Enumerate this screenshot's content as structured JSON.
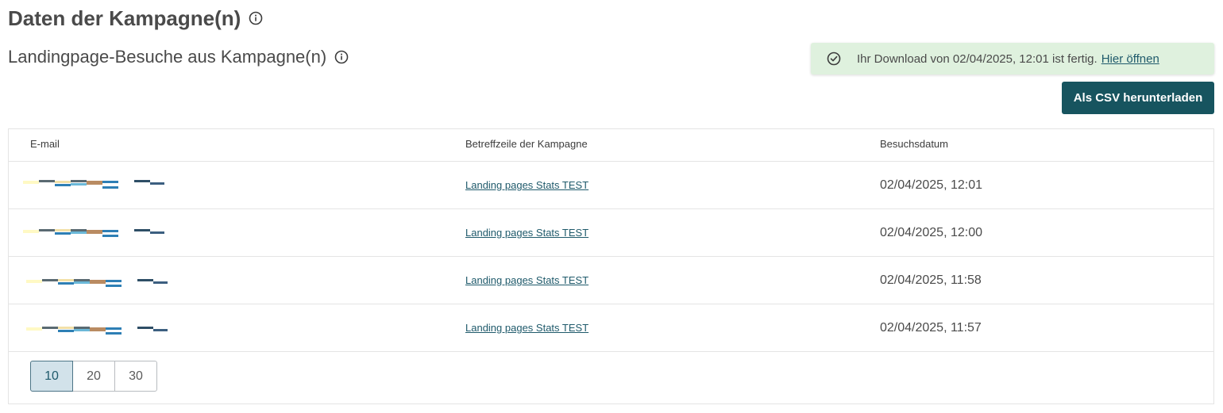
{
  "header": {
    "title": "Daten der Kampagne(n)",
    "title_icon": "info-icon",
    "subtitle": "Landingpage-Besuche aus Kampagne(n)",
    "subtitle_icon": "info-icon"
  },
  "toast": {
    "icon": "check-circle-icon",
    "message": "Ihr Download von 02/04/2025, 12:01 ist fertig.",
    "link_label": "Hier öffnen",
    "background": "#dff1de"
  },
  "actions": {
    "csv_label": "Als CSV herunterladen",
    "csv_color": "#17545f"
  },
  "table": {
    "columns": [
      "E-mail",
      "Betreffzeile der Kampagne",
      "Besuchsdatum"
    ],
    "rows": [
      {
        "email": "[redacted]",
        "subject": "Landing pages Stats TEST",
        "date": "02/04/2025, 12:01"
      },
      {
        "email": "[redacted]",
        "subject": "Landing pages Stats TEST",
        "date": "02/04/2025, 12:00"
      },
      {
        "email": "[redacted]",
        "subject": "Landing pages Stats TEST",
        "date": "02/04/2025, 11:58"
      },
      {
        "email": "[redacted]",
        "subject": "Landing pages Stats TEST",
        "date": "02/04/2025, 11:57"
      }
    ]
  },
  "pagination": {
    "options": [
      "10",
      "20",
      "30"
    ],
    "selected": "10"
  }
}
